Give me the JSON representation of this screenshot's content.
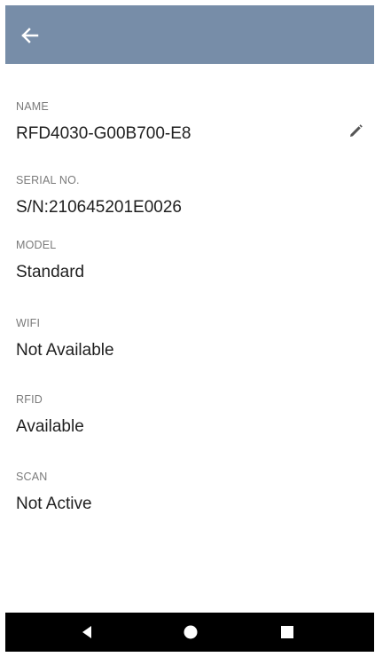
{
  "appbar": {
    "back_icon": "arrow-back-icon",
    "color": "#778da8"
  },
  "fields": {
    "name": {
      "label": "NAME",
      "value": "RFD4030-G00B700-E8",
      "edit_icon": "pencil-icon"
    },
    "serial": {
      "label": "SERIAL NO.",
      "value": "S/N:210645201E0026"
    },
    "model": {
      "label": "MODEL",
      "value": "Standard"
    },
    "wifi": {
      "label": "WIFI",
      "value": "Not Available"
    },
    "rfid": {
      "label": "RFID",
      "value": "Available"
    },
    "scan": {
      "label": "SCAN",
      "value": "Not Active"
    }
  },
  "navbar": {
    "back_icon": "nav-back-triangle-icon",
    "home_icon": "nav-home-circle-icon",
    "recents_icon": "nav-recents-square-icon",
    "color": "#000000"
  }
}
